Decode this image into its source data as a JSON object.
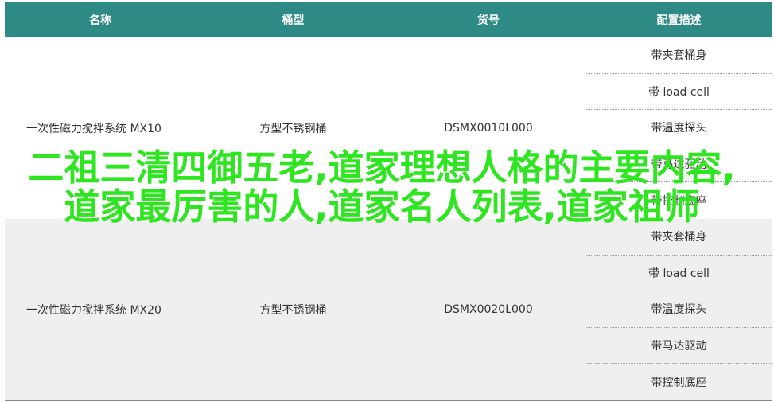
{
  "header": {
    "col1": "名称",
    "col2": "桶型",
    "col3": "货号",
    "col4": "配置描述"
  },
  "rows": [
    {
      "name": "一次性磁力搅拌系统 MX10",
      "type": "方型不锈钢桶",
      "sku": "DSMX0010L000",
      "configs": [
        "带夹套桶身",
        "带 load cell",
        "带温度探头",
        "带马达驱动",
        "带控制底座"
      ]
    },
    {
      "name": "一次性磁力搅拌系统 MX20",
      "type": "方型不锈钢桶",
      "sku": "DSMX0020L000",
      "configs": [
        "带夹套桶身",
        "带 load cell",
        "带温度探头",
        "带马达驱动",
        "带控制底座"
      ]
    }
  ],
  "overlay_text": "二祖三清四御五老,道家理想人格的主要内容,道家最厉害的人,道家名人列表,道家祖师",
  "colors": {
    "header_bg": "#2e8a85",
    "overlay_text": "#2ee61f",
    "row_alt_bg": "#efefef"
  }
}
